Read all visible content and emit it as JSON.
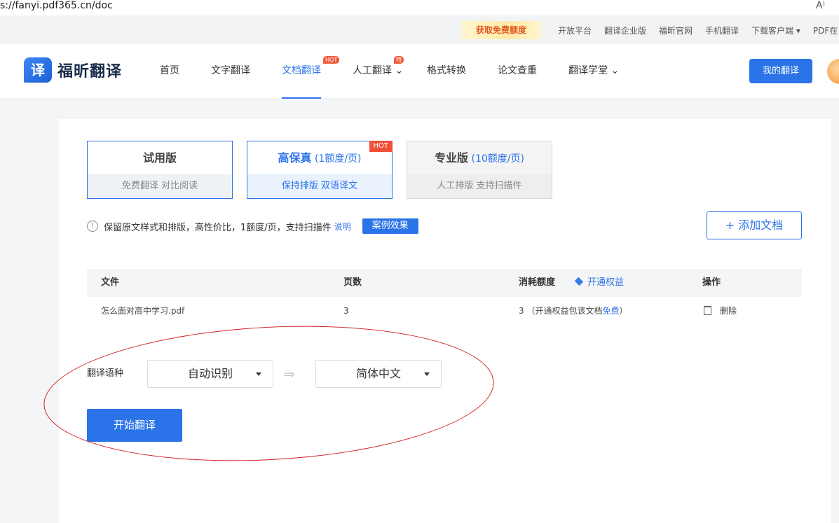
{
  "browser": {
    "url": "s://fanyi.pdf365.cn/doc",
    "read_icon": "A⁾"
  },
  "topbar": {
    "promo": "获取免费额度",
    "links": [
      "开放平台",
      "翻译企业版",
      "福昕官网",
      "手机翻译",
      "下载客户端 ▾",
      "PDF在"
    ]
  },
  "nav": {
    "logo_char": "译",
    "logo_text": "福昕翻译",
    "items": [
      {
        "label": "首页"
      },
      {
        "label": "文字翻译"
      },
      {
        "label": "文档翻译",
        "tag": "HOT"
      },
      {
        "label": "人工翻译 ⌄",
        "tag": "特价"
      },
      {
        "label": "格式转换"
      },
      {
        "label": "论文查重"
      },
      {
        "label": "翻译学堂 ⌄"
      }
    ],
    "my_translation": "我的翻译"
  },
  "versions": [
    {
      "title": "试用版",
      "sub": "",
      "footer": "免费翻译   对比阅读"
    },
    {
      "title": "高保真",
      "sub": " (1额度/页)",
      "footer": "保持排版   双语译文",
      "badge": "HOT"
    },
    {
      "title": "专业版",
      "sub": " (10额度/页)",
      "footer": "人工排版   支持扫描件"
    }
  ],
  "info": {
    "icon": "!",
    "text": "保留原文样式和排版，高性价比，1额度/页，支持扫描件",
    "link": "说明",
    "case_button": "案例效果"
  },
  "add_doc": "+ 添加文档",
  "table": {
    "headers": {
      "file": "文件",
      "pages": "页数",
      "cost": "消耗额度",
      "vip": "开通权益",
      "action": "操作"
    },
    "rows": [
      {
        "file": "怎么面对高中学习.pdf",
        "pages": "3",
        "cost": "3 （开通权益包该文档",
        "free": "免费",
        "cost_end": "）",
        "action": "删除"
      }
    ]
  },
  "language": {
    "label": "翻译语种",
    "source": "自动识别",
    "arrow": "⇒",
    "target": "简体中文"
  },
  "start_button": "开始翻译",
  "colors": {
    "accent": "#2b73e8",
    "hot": "#f0503a",
    "annotation": "#d21c1c"
  }
}
